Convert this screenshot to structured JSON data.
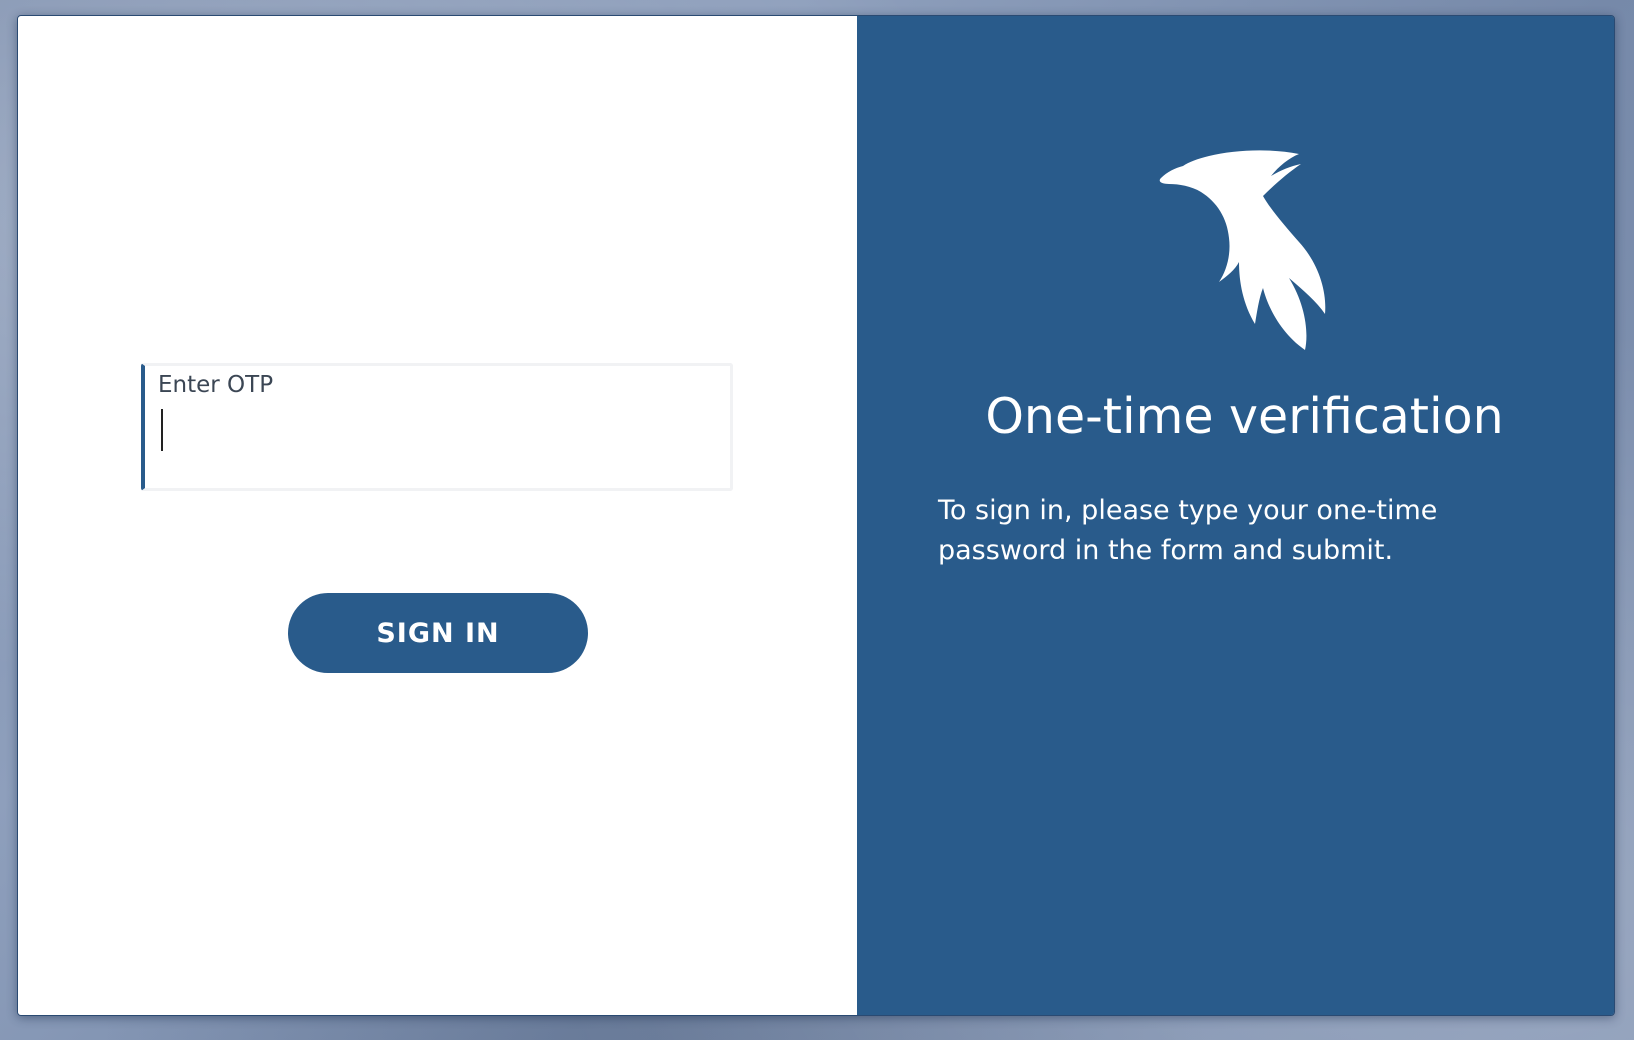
{
  "colors": {
    "brand": "#295b8b",
    "panel_left": "#ffffff",
    "text_on_brand": "#ffffff"
  },
  "form": {
    "otp_label": "Enter OTP",
    "otp_value": "",
    "signin_label": "SIGN IN"
  },
  "info": {
    "logo_icon": "phoenix-bird-icon",
    "title": "One-time verification",
    "description": "To sign in, please type your one-time password in the form and submit."
  }
}
